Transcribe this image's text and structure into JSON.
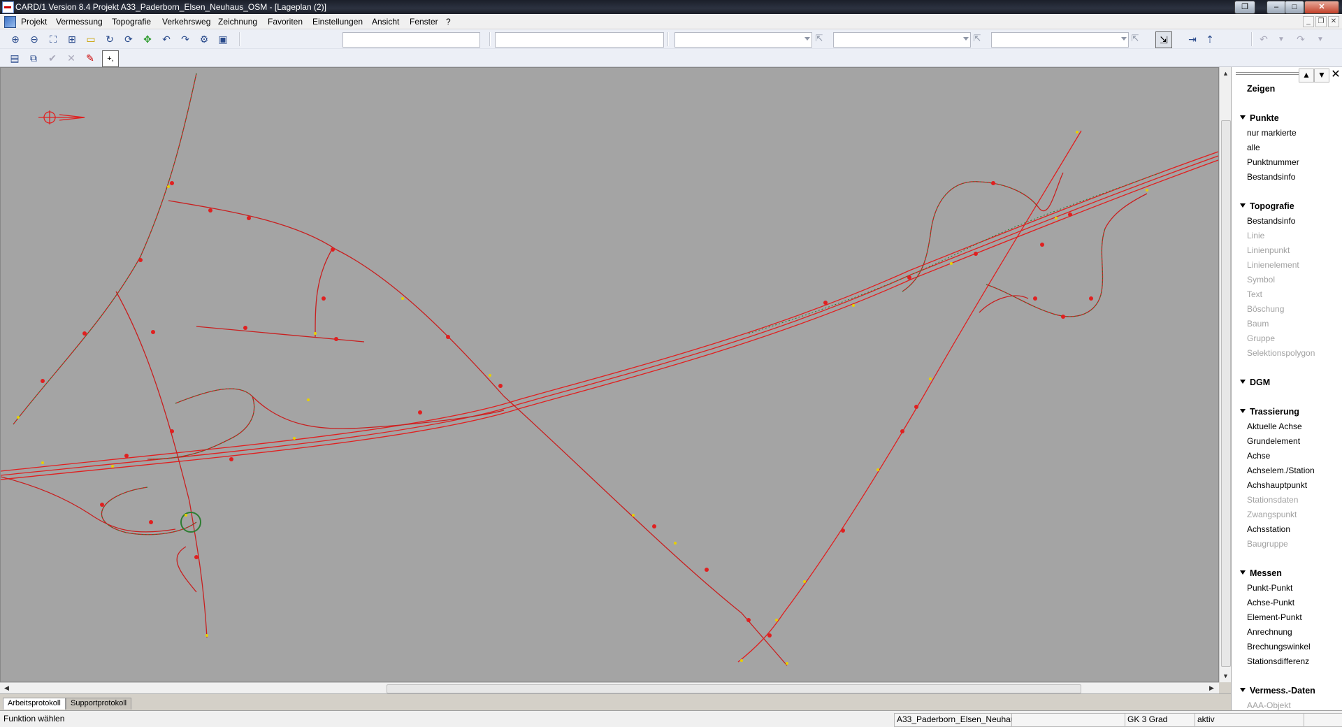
{
  "window": {
    "title": "CARD/1 Version 8.4 Projekt A33_Paderborn_Elsen_Neuhaus_OSM - [Lageplan (2)]"
  },
  "menu": {
    "items": [
      "Projekt",
      "Vermessung",
      "Topografie",
      "Verkehrsweg",
      "Zeichnung",
      "Favoriten",
      "Einstellungen",
      "Ansicht",
      "Fenster",
      "?"
    ]
  },
  "panel": {
    "title": "Zeigen",
    "sections": [
      {
        "header": "Punkte",
        "items": [
          {
            "label": "nur markierte",
            "enabled": true
          },
          {
            "label": "alle",
            "enabled": true
          },
          {
            "label": "Punktnummer",
            "enabled": true
          },
          {
            "label": "Bestandsinfo",
            "enabled": true
          }
        ]
      },
      {
        "header": "Topografie",
        "items": [
          {
            "label": "Bestandsinfo",
            "enabled": true
          },
          {
            "label": "Linie",
            "enabled": false
          },
          {
            "label": "Linienpunkt",
            "enabled": false
          },
          {
            "label": "Linienelement",
            "enabled": false
          },
          {
            "label": "Symbol",
            "enabled": false
          },
          {
            "label": "Text",
            "enabled": false
          },
          {
            "label": "Böschung",
            "enabled": false
          },
          {
            "label": "Baum",
            "enabled": false
          },
          {
            "label": "Gruppe",
            "enabled": false
          },
          {
            "label": "Selektionspolygon",
            "enabled": false
          }
        ]
      },
      {
        "header": "DGM",
        "items": []
      },
      {
        "header": "Trassierung",
        "items": [
          {
            "label": "Aktuelle Achse",
            "enabled": true
          },
          {
            "label": "Grundelement",
            "enabled": true
          },
          {
            "label": "Achse",
            "enabled": true
          },
          {
            "label": "Achselem./Station",
            "enabled": true
          },
          {
            "label": "Achshauptpunkt",
            "enabled": true
          },
          {
            "label": "Stationsdaten",
            "enabled": false
          },
          {
            "label": "Zwangspunkt",
            "enabled": false
          },
          {
            "label": "Achsstation",
            "enabled": true
          },
          {
            "label": "Baugruppe",
            "enabled": false
          }
        ]
      },
      {
        "header": "Messen",
        "items": [
          {
            "label": "Punkt-Punkt",
            "enabled": true
          },
          {
            "label": "Achse-Punkt",
            "enabled": true
          },
          {
            "label": "Element-Punkt",
            "enabled": true
          },
          {
            "label": "Anrechnung",
            "enabled": true
          },
          {
            "label": "Brechungswinkel",
            "enabled": true
          },
          {
            "label": "Stationsdifferenz",
            "enabled": true
          }
        ]
      },
      {
        "header": "Vermess.-Daten",
        "items": [
          {
            "label": "AAA-Objekt",
            "enabled": false
          }
        ]
      }
    ]
  },
  "tabs": [
    "Arbeitsprotokoll",
    "Supportprotokoll"
  ],
  "status": {
    "message": "Funktion wählen",
    "project": "A33_Paderborn_Elsen_Neuhau",
    "crs": "GK 3 Grad",
    "state": "aktiv"
  },
  "colors": {
    "canvas_bg": "#a4a4a4",
    "axis_line": "#e02020",
    "point_yellow": "#e8d000",
    "point_green": "#2e7d32"
  }
}
